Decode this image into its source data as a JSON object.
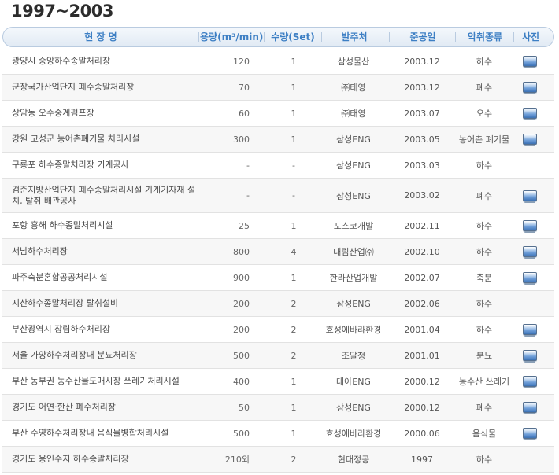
{
  "page": {
    "title": "1997~2003"
  },
  "table": {
    "headers": [
      "현 장 명",
      "용량(m³/min)",
      "수량(Set)",
      "발주처",
      "준공일",
      "악취종류",
      "사진"
    ],
    "rows": [
      {
        "name": "광양시 중앙하수종말처리장",
        "capacity": "120",
        "qty": "1",
        "client": "삼성물산",
        "date": "2003.12",
        "type": "하수",
        "photo": true,
        "icon": "photo-icon"
      },
      {
        "name": "군장국가산업단지 폐수종말처리장",
        "capacity": "70",
        "qty": "1",
        "client": "㈜태영",
        "date": "2003.12",
        "type": "폐수",
        "photo": true,
        "icon": "photo-icon"
      },
      {
        "name": "상암동 오수중계펌프장",
        "capacity": "60",
        "qty": "1",
        "client": "㈜태영",
        "date": "2003.07",
        "type": "오수",
        "photo": true,
        "icon": "photo-icon"
      },
      {
        "name": "강원 고성군 농어촌폐기물 처리시설",
        "capacity": "300",
        "qty": "1",
        "client": "삼성ENG",
        "date": "2003.05",
        "type": "농어촌 폐기물",
        "photo": true,
        "icon": "photo-icon"
      },
      {
        "name": "구룡포 하수종말처리장 기계공사",
        "capacity": "-",
        "qty": "-",
        "client": "삼성ENG",
        "date": "2003.03",
        "type": "하수",
        "photo": false
      },
      {
        "name": "검준지방산업단지 폐수종말처리시설 기계기자재 설치, 탈취 배관공사",
        "capacity": "-",
        "qty": "-",
        "client": "삼성ENG",
        "date": "2003.02",
        "type": "폐수",
        "photo": true,
        "icon": "photo-icon",
        "tall": true
      },
      {
        "name": "포항 흥해 하수종말처리시설",
        "capacity": "25",
        "qty": "1",
        "client": "포스코개발",
        "date": "2002.11",
        "type": "하수",
        "photo": true,
        "icon": "photo-icon"
      },
      {
        "name": "서남하수처리장",
        "capacity": "800",
        "qty": "4",
        "client": "대림산업㈜",
        "date": "2002.10",
        "type": "하수",
        "photo": true,
        "icon": "photo-icon"
      },
      {
        "name": "파주축분혼합공공처리시설",
        "capacity": "900",
        "qty": "1",
        "client": "한라산업개발",
        "date": "2002.07",
        "type": "축분",
        "photo": true,
        "icon": "photo-icon"
      },
      {
        "name": "지산하수종말처리장 탈취설비",
        "capacity": "200",
        "qty": "2",
        "client": "삼성ENG",
        "date": "2002.06",
        "type": "하수",
        "photo": false
      },
      {
        "name": "부산광역시 장림하수처리장",
        "capacity": "200",
        "qty": "2",
        "client": "효성에바라환경",
        "date": "2001.04",
        "type": "하수",
        "photo": true,
        "icon": "photo-icon"
      },
      {
        "name": "서울 가양하수처리장내 분뇨처리장",
        "capacity": "500",
        "qty": "2",
        "client": "조달청",
        "date": "2001.01",
        "type": "분뇨",
        "photo": true,
        "icon": "photo-icon"
      },
      {
        "name": "부산 동부권 농수산물도매시장 쓰레기처리시설",
        "capacity": "400",
        "qty": "1",
        "client": "대아ENG",
        "date": "2000.12",
        "type": "농수산 쓰레기",
        "photo": true,
        "icon": "photo-icon"
      },
      {
        "name": "경기도 어연·한산 폐수처리장",
        "capacity": "50",
        "qty": "1",
        "client": "삼성ENG",
        "date": "2000.12",
        "type": "폐수",
        "photo": true,
        "icon": "photo-icon"
      },
      {
        "name": "부산 수영하수처리장내 음식물병합처리시설",
        "capacity": "500",
        "qty": "1",
        "client": "효성에바라환경",
        "date": "2000.06",
        "type": "음식물",
        "photo": true,
        "icon": "photo-icon"
      },
      {
        "name": "경기도 용인수지 하수종말처리장",
        "capacity": "210외",
        "qty": "2",
        "client": "현대정공",
        "date": "1997",
        "type": "하수",
        "photo": false
      }
    ]
  }
}
